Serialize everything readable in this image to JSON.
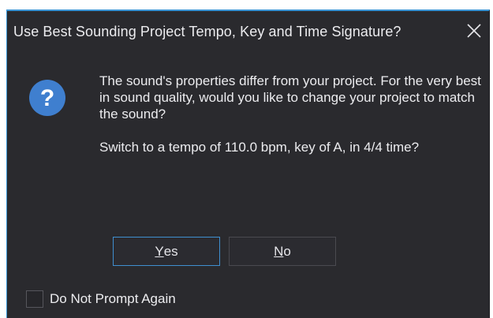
{
  "dialog": {
    "title": "Use Best Sounding Project Tempo, Key and Time Signature?",
    "close_icon": "close-icon",
    "help_icon": "question-mark-icon",
    "message_line1": "The sound's properties differ from your project.  For the very best in sound quality, would you like to change your project to match the sound?",
    "message_line2": "Switch to a tempo of 110.0 bpm, key of A, in 4/4 time?",
    "yes_mnemonic": "Y",
    "yes_rest": "es",
    "no_mnemonic": "N",
    "no_rest": "o",
    "checkbox_label": "Do Not Prompt Again",
    "checkbox_checked": false
  },
  "colors": {
    "background": "#2a2a2e",
    "accent": "#3a95d6",
    "text": "#ececef",
    "help_icon_fill": "#3f7fcf"
  }
}
